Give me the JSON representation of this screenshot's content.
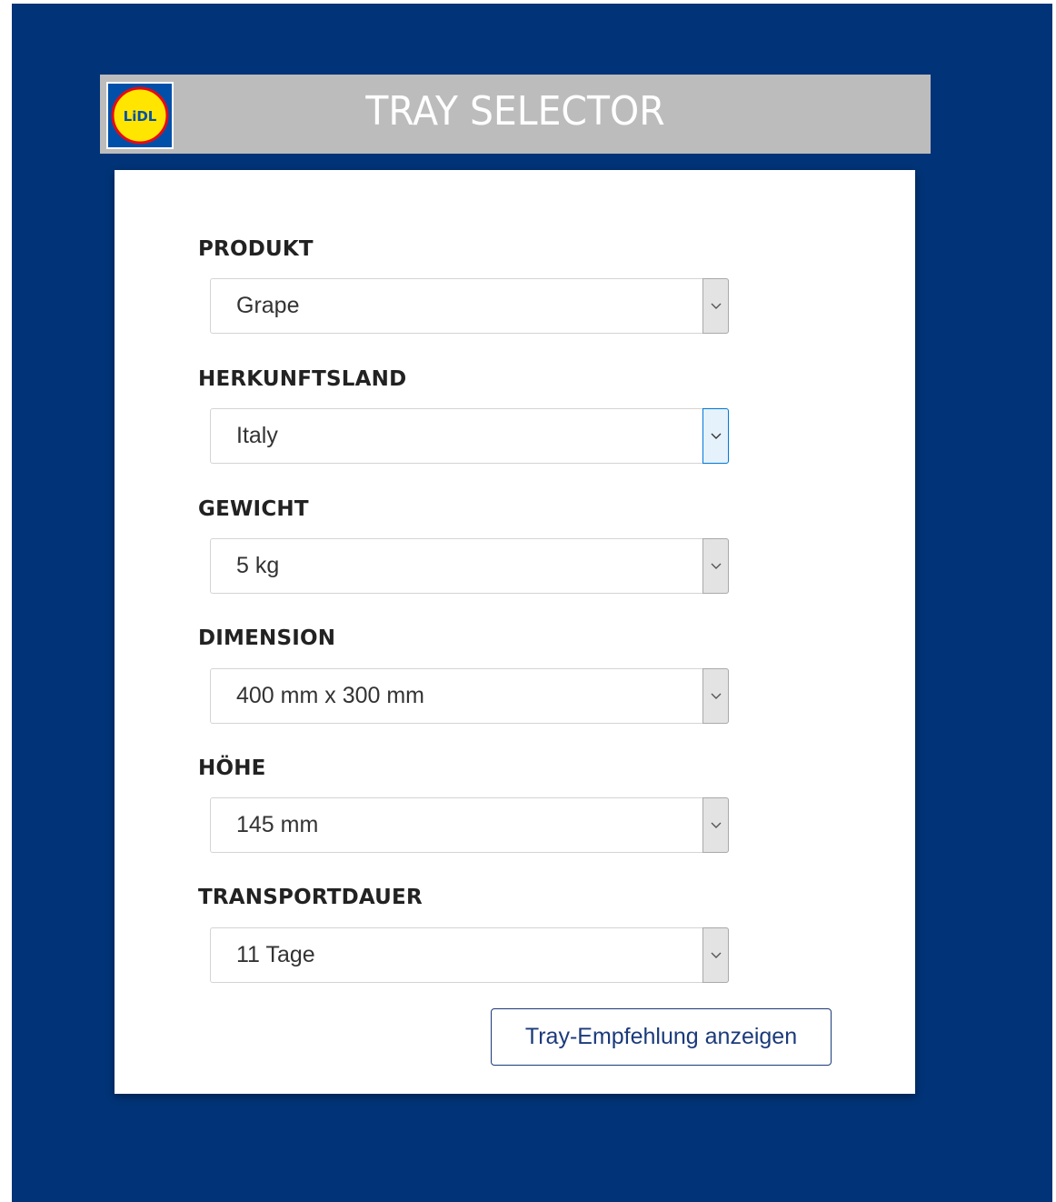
{
  "colors": {
    "background": "#003377",
    "header_background": "#bcbcbc",
    "accent": "#1b3a7a",
    "logo_blue": "#0050aa",
    "logo_yellow": "#ffe500",
    "logo_red": "#e60a14"
  },
  "header": {
    "title": "TRAY SELECTOR",
    "logo_text": "LiDL"
  },
  "form": {
    "fields": [
      {
        "label": "PRODUKT",
        "value": "Grape",
        "icon": "chevron-down-icon"
      },
      {
        "label": "HERKUNFTSLAND",
        "value": "Italy",
        "icon": "chevron-down-icon"
      },
      {
        "label": "GEWICHT",
        "value": "5 kg",
        "icon": "chevron-down-icon"
      },
      {
        "label": "DIMENSION",
        "value": "400 mm x 300 mm",
        "icon": "chevron-down-icon"
      },
      {
        "label": "HÖHE",
        "value": "145 mm",
        "icon": "chevron-down-icon"
      },
      {
        "label": "TRANSPORTDAUER",
        "value": "11 Tage",
        "icon": "chevron-down-icon"
      }
    ],
    "submit_label": "Tray-Empfehlung anzeigen"
  }
}
